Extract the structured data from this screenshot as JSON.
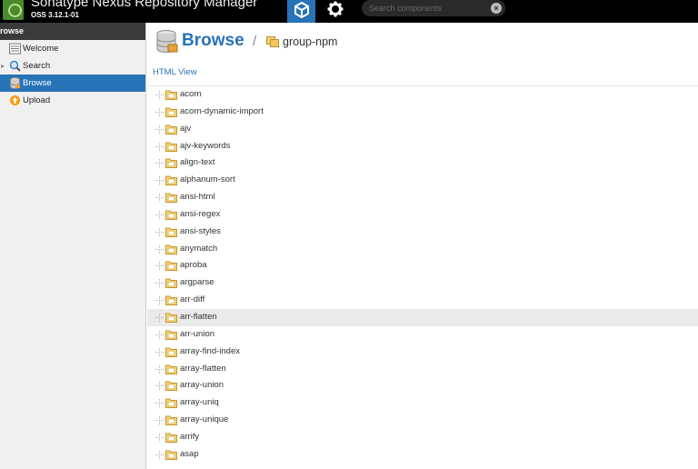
{
  "app": {
    "title": "Sonatype Nexus Repository Manager",
    "version": "OSS 3.12.1-01"
  },
  "search": {
    "placeholder": "Search components"
  },
  "sidebar": {
    "header": "rowse",
    "items": [
      {
        "label": "Welcome",
        "icon": "list-icon"
      },
      {
        "label": "Search",
        "icon": "magnifier-icon"
      },
      {
        "label": "Browse",
        "icon": "database-icon"
      },
      {
        "label": "Upload",
        "icon": "upload-icon"
      }
    ]
  },
  "main": {
    "title": "Browse",
    "breadcrumb": "group-npm",
    "html_view": "HTML View"
  },
  "tree": {
    "items": [
      "acorn",
      "acorn-dynamic-import",
      "ajv",
      "ajv-keywords",
      "align-text",
      "alphanum-sort",
      "ansi-html",
      "ansi-regex",
      "ansi-styles",
      "anymatch",
      "aproba",
      "argparse",
      "arr-diff",
      "arr-flatten",
      "arr-union",
      "array-find-index",
      "array-flatten",
      "array-union",
      "array-uniq",
      "array-unique",
      "arrify",
      "asap"
    ],
    "highlighted_index": 13
  },
  "colors": {
    "accent": "#2773b8",
    "topbar": "#000000",
    "sidebar_bg": "#f0f0f0",
    "row_highlight": "#eaeaea"
  }
}
